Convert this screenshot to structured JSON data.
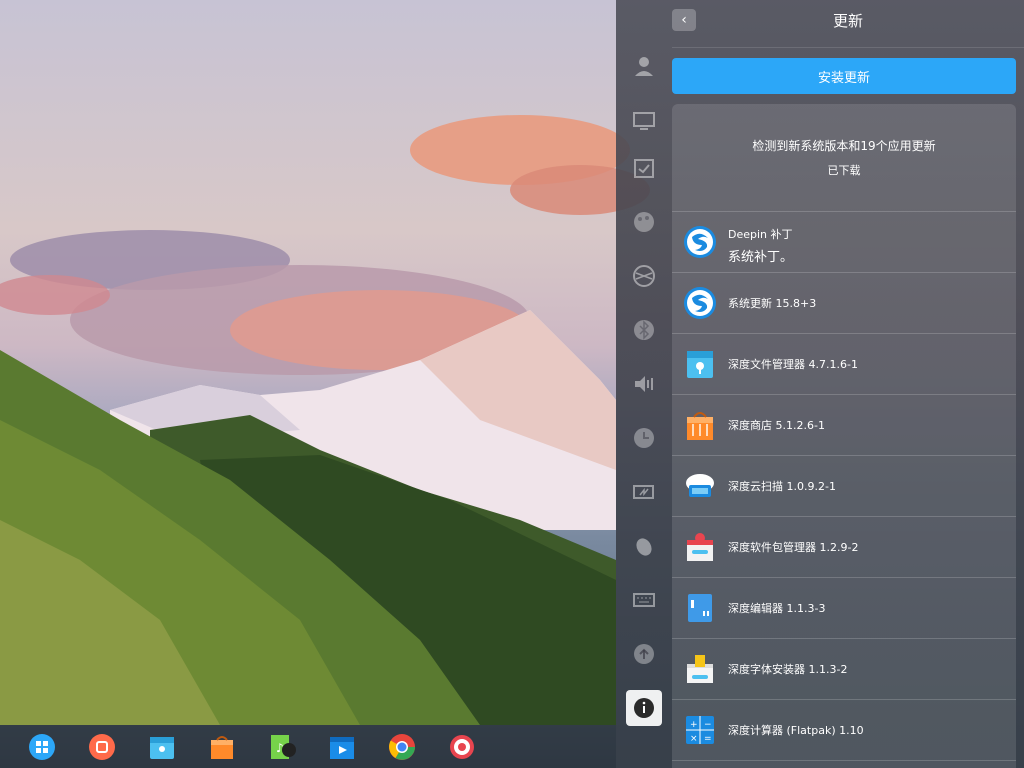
{
  "dock": {
    "items": [
      {
        "name": "launcher-icon"
      },
      {
        "name": "multitask-view-icon"
      },
      {
        "name": "file-manager-icon"
      },
      {
        "name": "app-store-icon"
      },
      {
        "name": "music-player-icon"
      },
      {
        "name": "movie-player-icon"
      },
      {
        "name": "chrome-icon"
      },
      {
        "name": "control-center-icon"
      }
    ]
  },
  "control_center": {
    "title": "更新",
    "back_glyph": "‹",
    "install_label": "安装更新",
    "summary_text": "检测到新系统版本和19个应用更新",
    "summary_status": "已下载",
    "nav_items": [
      {
        "name": "accounts-icon"
      },
      {
        "name": "display-icon"
      },
      {
        "name": "default-apps-icon"
      },
      {
        "name": "personalization-icon"
      },
      {
        "name": "network-icon"
      },
      {
        "name": "bluetooth-icon"
      },
      {
        "name": "sound-icon"
      },
      {
        "name": "datetime-icon"
      },
      {
        "name": "power-icon"
      },
      {
        "name": "mouse-icon"
      },
      {
        "name": "keyboard-icon"
      },
      {
        "name": "update-icon"
      },
      {
        "name": "system-info-icon"
      }
    ],
    "updates": [
      {
        "name": "Deepin 补丁",
        "desc": "系统补丁。",
        "icon": "deepin-logo-icon"
      },
      {
        "name": "系统更新 15.8+3",
        "icon": "deepin-logo-icon"
      },
      {
        "name": "深度文件管理器 4.7.1.6-1",
        "icon": "file-manager-icon"
      },
      {
        "name": "深度商店 5.1.2.6-1",
        "icon": "app-store-icon"
      },
      {
        "name": "深度云扫描 1.0.9.2-1",
        "icon": "cloud-scanner-icon"
      },
      {
        "name": "深度软件包管理器 1.2.9-2",
        "icon": "package-manager-icon"
      },
      {
        "name": "深度编辑器 1.1.3-3",
        "icon": "text-editor-icon"
      },
      {
        "name": "深度字体安装器 1.1.3-2",
        "icon": "font-installer-icon"
      },
      {
        "name": "深度计算器 (Flatpak) 1.10",
        "icon": "calculator-icon"
      }
    ]
  }
}
